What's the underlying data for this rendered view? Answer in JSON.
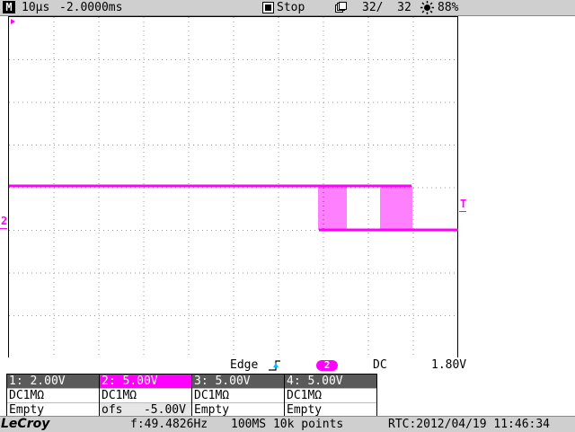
{
  "topbar": {
    "mode_letter": "M",
    "timebase": "10µs",
    "delay": "-2.0000ms",
    "run_state": "Stop",
    "acq_count": "32/  32",
    "brightness": "88%"
  },
  "grid": {
    "channel_marker_label": "2",
    "trigger_marker_label": "T"
  },
  "trigger": {
    "type": "Edge",
    "source_channel": "2",
    "coupling": "DC",
    "level": "1.80V"
  },
  "channels": [
    {
      "header": "1: 2.00V",
      "line1": "DC1MΩ",
      "line2": "Empty"
    },
    {
      "header": "2: 5.00V",
      "line1": "DC1MΩ",
      "line2": "ofs   -5.00V"
    },
    {
      "header": "3: 5.00V",
      "line1": "DC1MΩ",
      "line2": "Empty"
    },
    {
      "header": "4: 5.00V",
      "line1": "DC1MΩ",
      "line2": "Empty"
    }
  ],
  "bottombar": {
    "logo": "LeCroy",
    "frequency": "f:49.4826Hz",
    "sample_info": "100MS 10k points",
    "rtc": "RTC:2012/04/19 11:46:34"
  },
  "colors": {
    "trace": "#ff00ff",
    "active_channel": "#ff00ff",
    "trigger_icon": "#00bfff"
  }
}
